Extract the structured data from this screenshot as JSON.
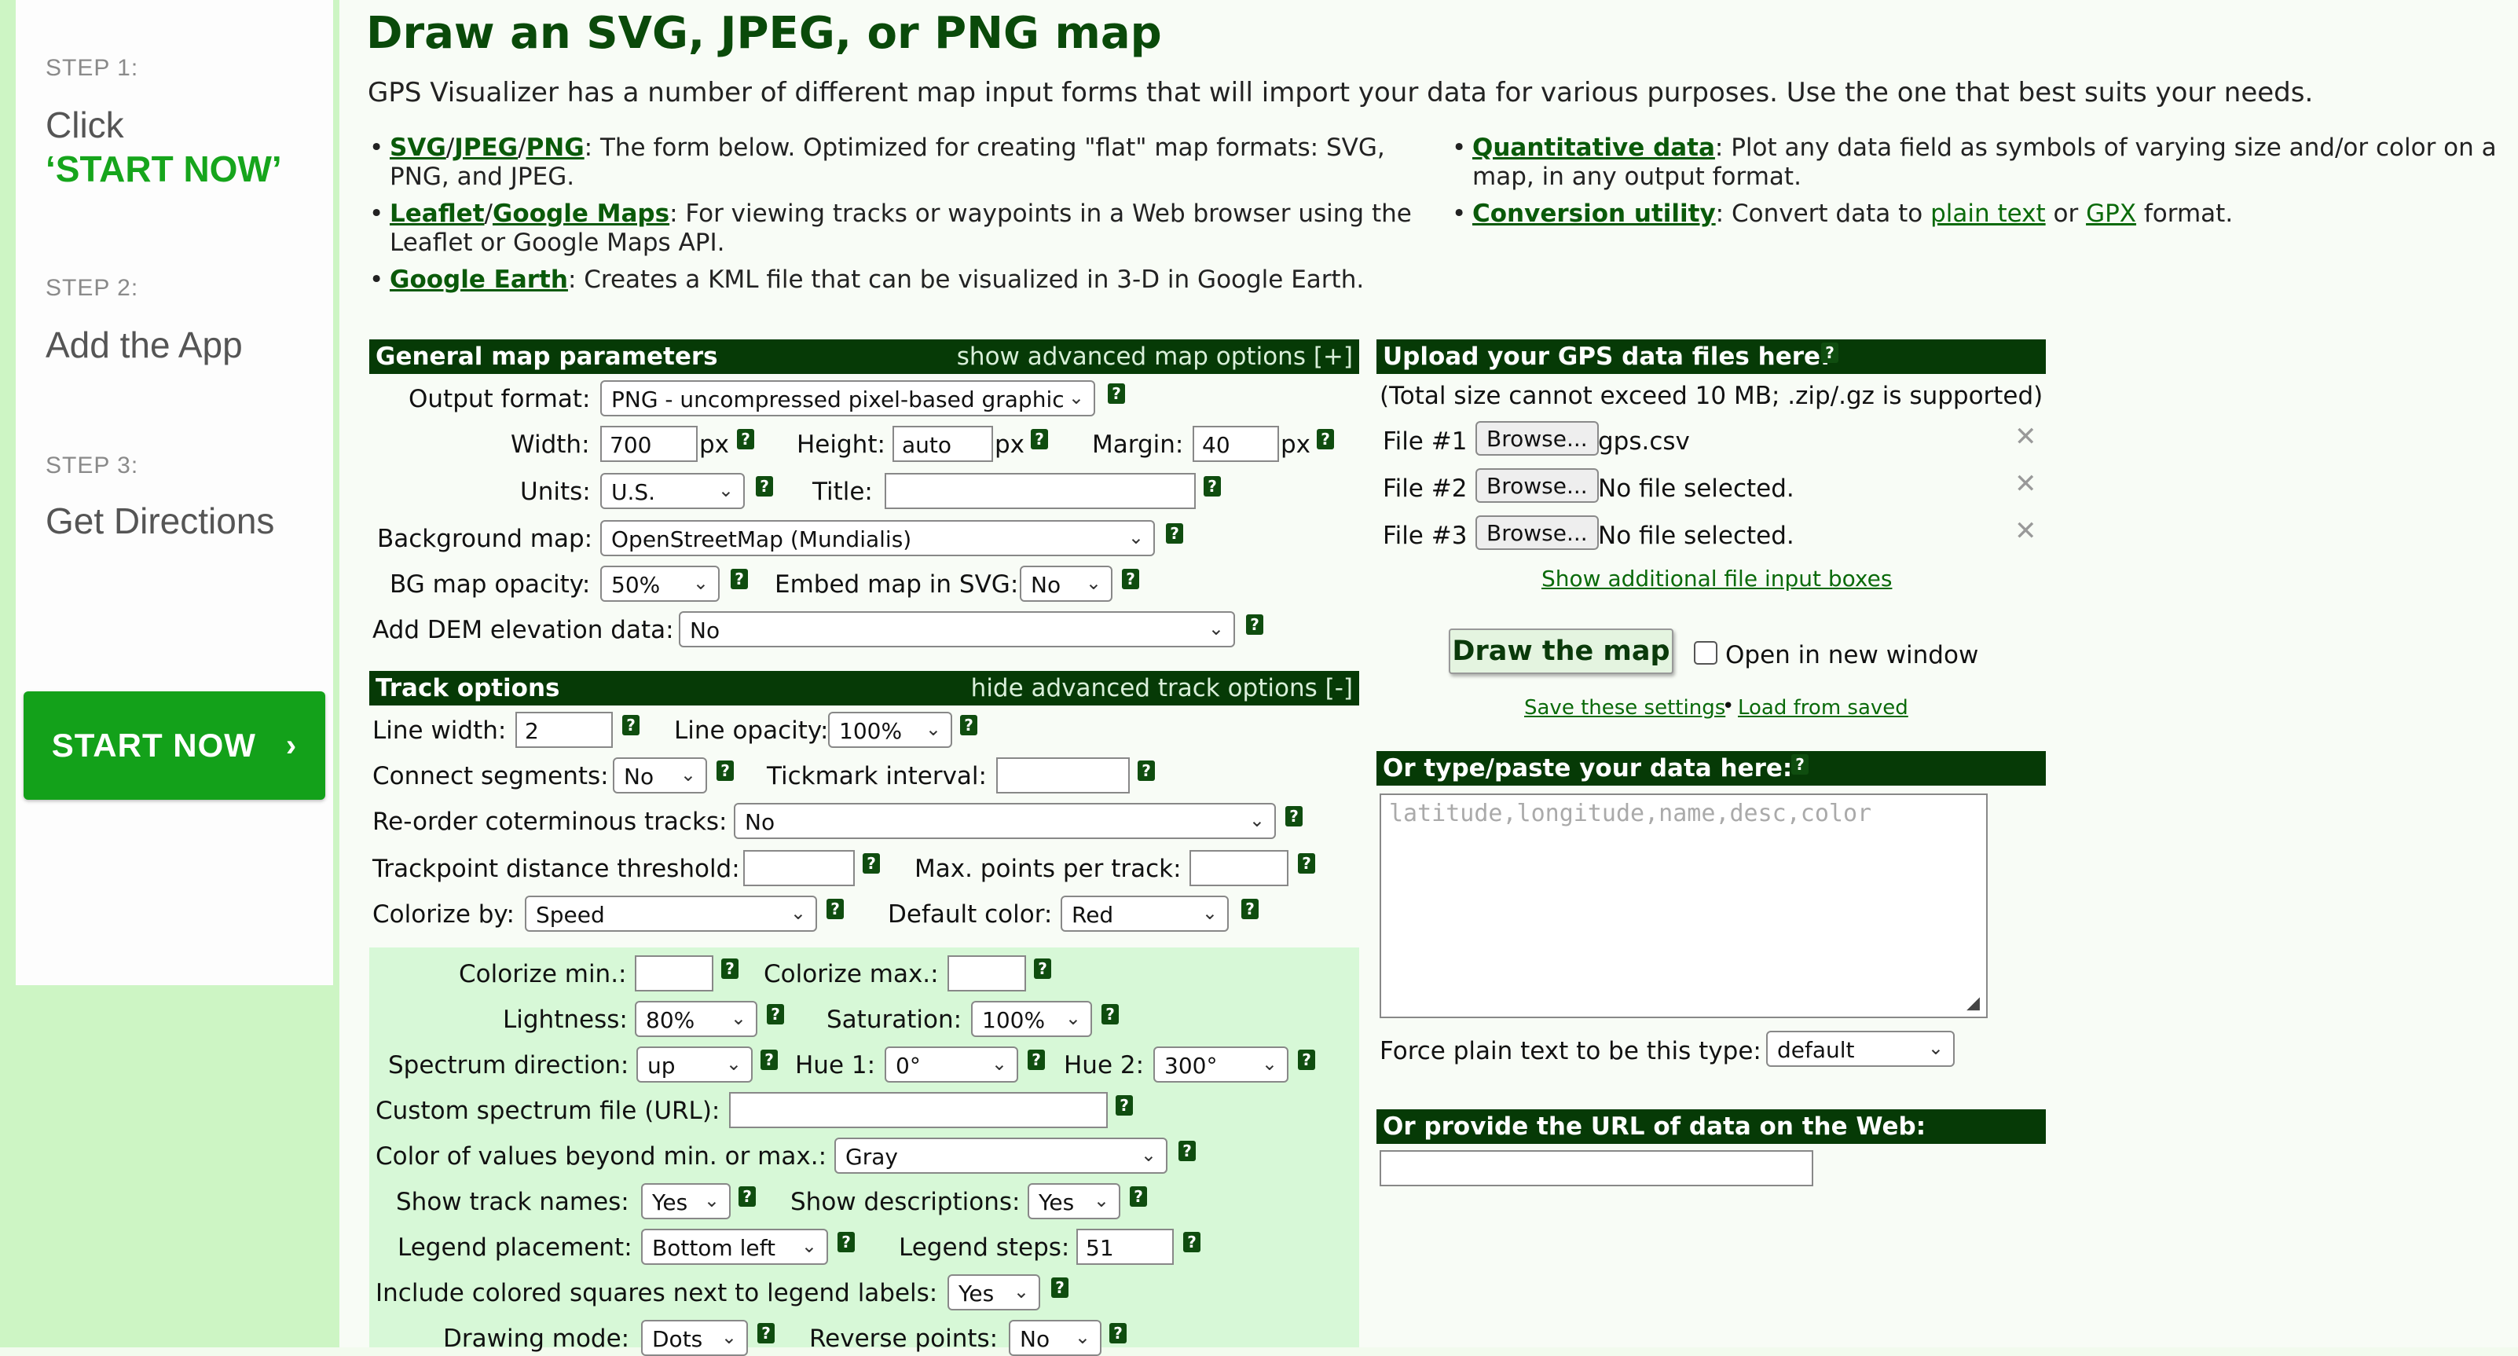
{
  "ad": {
    "step1": "STEP 1:",
    "step1_text": "Click",
    "step1_cta": "‘START NOW’",
    "step2": "STEP 2:",
    "step2_text": "Add the App",
    "step3": "STEP 3:",
    "step3_text": "Get Directions",
    "button": "START NOW",
    "button_chevron": "›"
  },
  "page": {
    "title": "Draw an SVG, JPEG, or PNG map",
    "intro": "GPS Visualizer has a number of different map input forms that will import your data for various purposes. Use the one that best suits your needs."
  },
  "bullets": {
    "b1": {
      "l1": "SVG",
      "l2": "JPEG",
      "l3": "PNG",
      "text": ": The form below. Optimized for creating \"flat\" map formats: SVG, PNG, and JPEG."
    },
    "b2": {
      "l1": "Leaflet",
      "l2": "Google Maps",
      "text": ": For viewing tracks or waypoints in a Web browser using the Leaflet or Google Maps API."
    },
    "b3": {
      "l1": "Google Earth",
      "text": ": Creates a KML file that can be visualized in 3-D in Google Earth."
    },
    "b4": {
      "l1": "Quantitative data",
      "text": ": Plot any data field as symbols of varying size and/or color on a map, in any output format."
    },
    "b5": {
      "l1": "Conversion utility",
      "text_a": ": Convert data to ",
      "l2": "plain text",
      "text_b": " or ",
      "l3": "GPX",
      "text_c": " format."
    }
  },
  "general": {
    "header": "General map parameters",
    "toggle": "show advanced map options [+]",
    "output_format_label": "Output format:",
    "output_format": "PNG - uncompressed pixel-based graphic",
    "width_label": "Width:",
    "width": "700",
    "px": "px",
    "height_label": "Height:",
    "height": "auto",
    "margin_label": "Margin:",
    "margin": "40",
    "units_label": "Units:",
    "units": "U.S.",
    "title_label": "Title:",
    "title": "",
    "bg_label": "Background map:",
    "bg": "OpenStreetMap (Mundialis)",
    "opacity_label": "BG map opacity:",
    "opacity": "50%",
    "embed_label": "Embed map in SVG:",
    "embed": "No",
    "dem_label": "Add DEM elevation data:",
    "dem": "No"
  },
  "track": {
    "header": "Track options",
    "toggle": "hide advanced track options [-]",
    "line_width_label": "Line width:",
    "line_width": "2",
    "line_opacity_label": "Line opacity:",
    "line_opacity": "100%",
    "connect_label": "Connect segments:",
    "connect": "No",
    "tick_label": "Tickmark interval:",
    "tick": "",
    "reorder_label": "Re-order coterminous tracks:",
    "reorder": "No",
    "threshold_label": "Trackpoint distance threshold:",
    "threshold": "",
    "maxpts_label": "Max. points per track:",
    "maxpts": "",
    "colorize_label": "Colorize by:",
    "colorize": "Speed",
    "default_color_label": "Default color:",
    "default_color": "Red",
    "cmin_label": "Colorize min.:",
    "cmax_label": "Colorize max.:",
    "lightness_label": "Lightness:",
    "lightness": "80%",
    "saturation_label": "Saturation:",
    "saturation": "100%",
    "spectrum_label": "Spectrum direction:",
    "spectrum": "up",
    "hue1_label": "Hue 1:",
    "hue1": "0°",
    "hue2_label": "Hue 2:",
    "hue2": "300°",
    "custom_label": "Custom spectrum file (URL):",
    "beyond_label": "Color of values beyond min. or max.:",
    "beyond": "Gray",
    "names_label": "Show track names:",
    "names": "Yes",
    "desc_label": "Show descriptions:",
    "desc": "Yes",
    "legend_label": "Legend placement:",
    "legend": "Bottom left",
    "steps_label": "Legend steps:",
    "steps": "51",
    "squares_label": "Include colored squares next to legend labels:",
    "squares": "Yes",
    "mode_label": "Drawing mode:",
    "mode": "Dots",
    "reverse_label": "Reverse points:",
    "reverse": "No"
  },
  "upload": {
    "header": "Upload your GPS data files here:",
    "note": "(Total size cannot exceed 10 MB; .zip/.gz is supported)",
    "files": [
      {
        "label": "File #1",
        "button": "Browse...",
        "name": "gps.csv"
      },
      {
        "label": "File #2",
        "button": "Browse...",
        "name": "No file selected."
      },
      {
        "label": "File #3",
        "button": "Browse...",
        "name": "No file selected."
      }
    ],
    "more": "Show additional file input boxes",
    "draw": "Draw the map",
    "new_window": "Open in new window",
    "save": "Save these settings",
    "sep": "•",
    "load": "Load from saved"
  },
  "paste": {
    "header": "Or type/paste your data here:",
    "placeholder": "latitude,longitude,name,desc,color",
    "force_label": "Force plain text to be this type:",
    "force": "default"
  },
  "url": {
    "header": "Or provide the URL of data on the Web:",
    "value": ""
  },
  "icons": {
    "help": "help-icon",
    "remove": "close-icon",
    "dropdown": "chevron-down-icon"
  },
  "colors": {
    "header_bg": "#063a06",
    "link": "#0a5a0a",
    "panel": "#d7f8d7",
    "cta": "#13a11a"
  }
}
